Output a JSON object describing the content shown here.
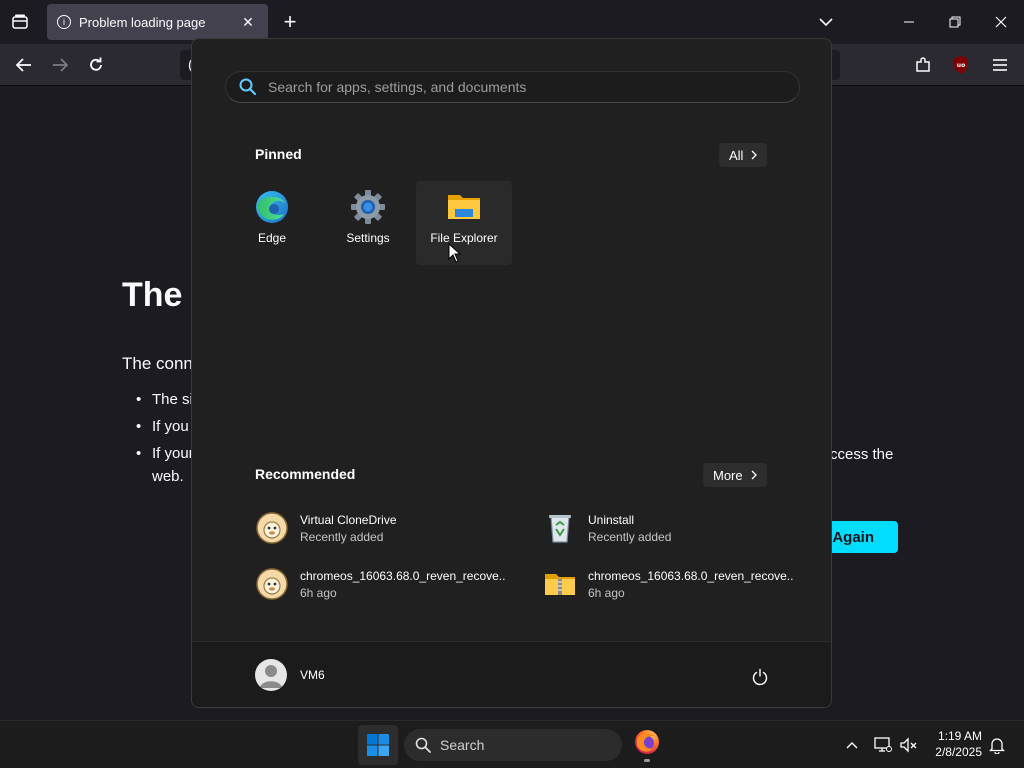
{
  "browser": {
    "tab_title": "Problem loading page",
    "tab_close": "✕",
    "new_tab": "+"
  },
  "page": {
    "title_visible": "The c",
    "description_visible": "The conn",
    "bullets_visible": [
      "The si",
      "If you",
      "If your"
    ],
    "bullet_continuation": "web.",
    "bullet_right_fragment": "ccess the",
    "try_again_label": "Again"
  },
  "start_menu": {
    "search_placeholder": "Search for apps, settings, and documents",
    "pinned_title": "Pinned",
    "all_button": "All",
    "pinned_apps": [
      {
        "label": "Edge",
        "icon": "edge-icon"
      },
      {
        "label": "Settings",
        "icon": "settings-gear-icon"
      },
      {
        "label": "File Explorer",
        "icon": "folder-icon"
      }
    ],
    "recommended_title": "Recommended",
    "more_button": "More",
    "recommended": [
      {
        "name": "Virtual CloneDrive",
        "sub": "Recently added",
        "icon": "sheep-icon"
      },
      {
        "name": "Uninstall",
        "sub": "Recently added",
        "icon": "recycle-bin-icon"
      },
      {
        "name": "chromeos_16063.68.0_reven_recove...",
        "sub": "6h ago",
        "icon": "sheep-icon"
      },
      {
        "name": "chromeos_16063.68.0_reven_recove...",
        "sub": "6h ago",
        "icon": "zip-folder-icon"
      }
    ],
    "user_name": "VM6"
  },
  "taskbar": {
    "search_label": "Search",
    "time": "1:19 AM",
    "date": "2/8/2025"
  },
  "colors": {
    "accent_cyan": "#00ddff",
    "start_bg": "#202020",
    "windows_blue": "#0078d4"
  }
}
